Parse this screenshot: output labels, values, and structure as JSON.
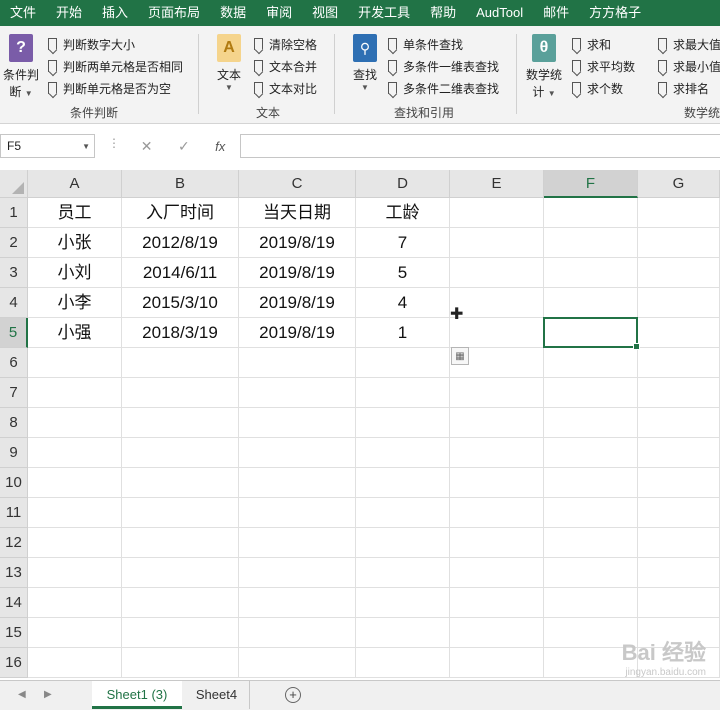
{
  "ribbon_tabs": [
    "文件",
    "开始",
    "插入",
    "页面布局",
    "数据",
    "审阅",
    "视图",
    "开发工具",
    "帮助",
    "AudTool",
    "邮件",
    "方方格子"
  ],
  "ribbon": {
    "cond_group": {
      "big_label_line1": "条件判",
      "big_label_line2": "断",
      "items": [
        "判断数字大小",
        "判断两单元格是否相同",
        "判断单元格是否为空"
      ],
      "label": "条件判断"
    },
    "text_group": {
      "big_label": "文本",
      "items": [
        "清除空格",
        "文本合并",
        "文本对比"
      ],
      "label": "文本"
    },
    "lookup_group": {
      "big_label": "查找",
      "items": [
        "单条件查找",
        "多条件一维表查找",
        "多条件二维表查找"
      ],
      "label": "查找和引用"
    },
    "stat_group": {
      "big_label_line1": "数学统",
      "big_label_line2": "计",
      "items": [
        "求和",
        "求平均数",
        "求个数"
      ],
      "items2": [
        "求最大值",
        "求最小值",
        "求排名"
      ],
      "label": "数学统"
    }
  },
  "formula_bar": {
    "name_box": "F5",
    "fx": "fx",
    "formula": ""
  },
  "columns": [
    "A",
    "B",
    "C",
    "D",
    "E",
    "F",
    "G"
  ],
  "selected_column": "F",
  "rows": [
    "1",
    "2",
    "3",
    "4",
    "5",
    "6",
    "7",
    "8",
    "9",
    "10",
    "11",
    "12",
    "13",
    "14",
    "15",
    "16"
  ],
  "selected_row": "5",
  "table": [
    [
      "员工",
      "入厂时间",
      "当天日期",
      "工龄"
    ],
    [
      "小张",
      "2012/8/19",
      "2019/8/19",
      "7"
    ],
    [
      "小刘",
      "2014/6/11",
      "2019/8/19",
      "5"
    ],
    [
      "小李",
      "2015/3/10",
      "2019/8/19",
      "4"
    ],
    [
      "小强",
      "2018/3/19",
      "2019/8/19",
      "1"
    ]
  ],
  "sheets": [
    "Sheet1 (3)",
    "Sheet4"
  ],
  "active_sheet": "Sheet1 (3)",
  "watermark": {
    "main": "Bai 经验",
    "sub": "jingyan.baidu.com"
  }
}
